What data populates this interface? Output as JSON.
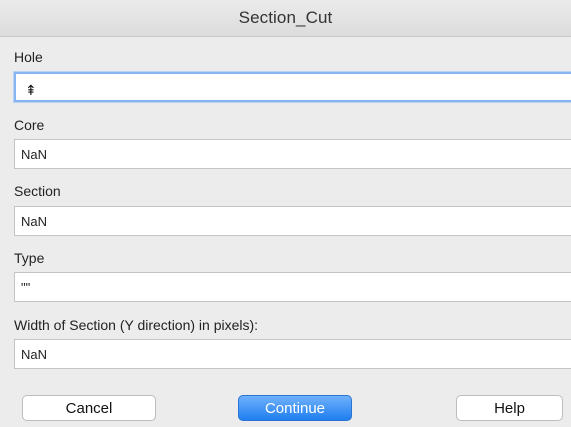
{
  "window": {
    "title": "Section_Cut"
  },
  "fields": {
    "hole": {
      "label": "Hole",
      "value": ""
    },
    "core": {
      "label": "Core",
      "value": "NaN"
    },
    "section": {
      "label": "Section",
      "value": "NaN"
    },
    "type": {
      "label": "Type",
      "value": "\"\""
    },
    "width": {
      "label": "Width of Section (Y direction) in pixels):",
      "value": "NaN"
    }
  },
  "buttons": {
    "cancel": "Cancel",
    "continue": "Continue",
    "help": "Help"
  },
  "colors": {
    "dialog_background": "#ececec",
    "primary_button": "#1f7ef0",
    "focus_ring": "#86b5f2"
  }
}
